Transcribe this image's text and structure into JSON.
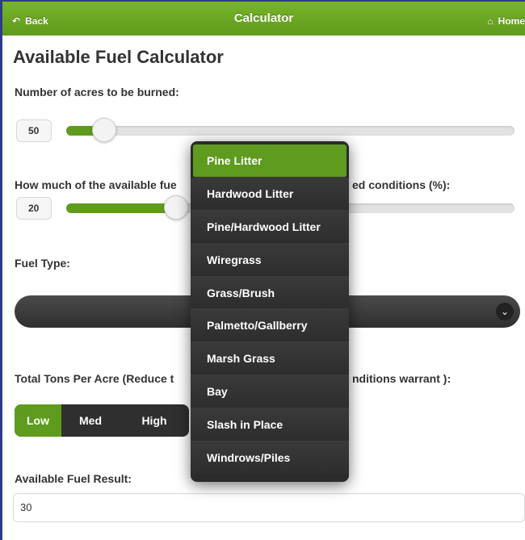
{
  "header": {
    "back_label": "Back",
    "title": "Calculator",
    "home_label": "Home"
  },
  "page": {
    "title": "Available Fuel Calculator"
  },
  "acres": {
    "label": "Number of acres to be burned:",
    "value": "50",
    "slider_fraction": 0.04
  },
  "percent": {
    "label_left": "How much of the available fue",
    "label_right": "ed conditions (%):",
    "value": "20",
    "slider_fraction": 0.2
  },
  "fuel_type": {
    "label": "Fuel Type:",
    "selected": "",
    "options": [
      "Pine Litter",
      "Hardwood Litter",
      "Pine/Hardwood Litter",
      "Wiregrass",
      "Grass/Brush",
      "Palmetto/Gallberry",
      "Marsh Grass",
      "Bay",
      "Slash in Place",
      "Windrows/Piles"
    ],
    "highlighted_index": 0
  },
  "tons": {
    "label_left": "Total Tons Per Acre (Reduce t",
    "label_right": "nditions warrant ):",
    "options": [
      "Low",
      "Med",
      "High"
    ],
    "active": "Low"
  },
  "result": {
    "label": "Available Fuel Result:",
    "value": "30"
  },
  "colors": {
    "accent": "#5e9b1e",
    "header": "#6aa623",
    "dark": "#2f2f2f"
  }
}
